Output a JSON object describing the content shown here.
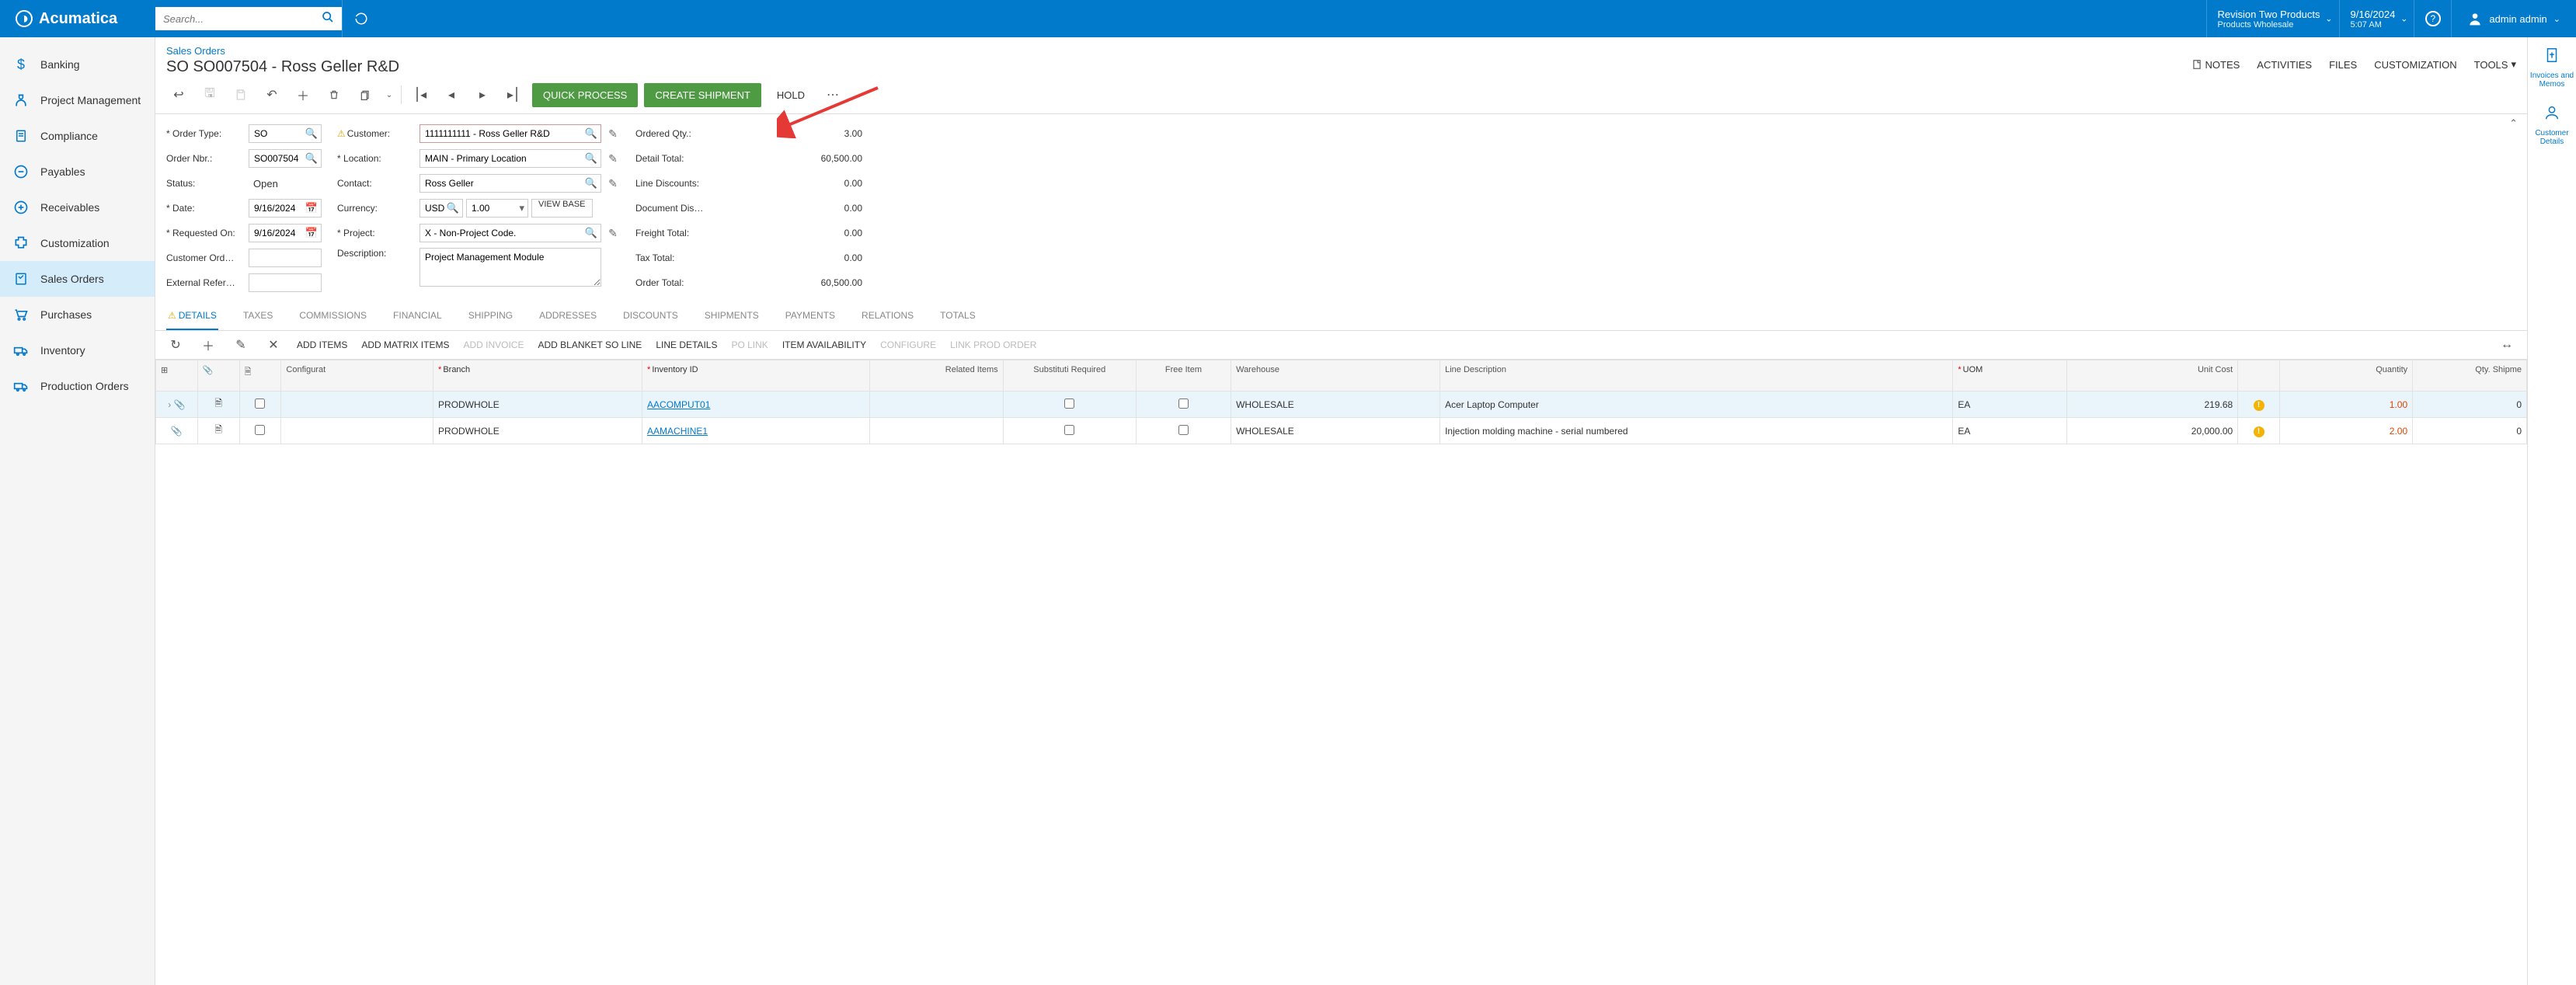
{
  "header": {
    "brand": "Acumatica",
    "search_placeholder": "Search...",
    "tenant": {
      "line1": "Revision Two Products",
      "line2": "Products Wholesale"
    },
    "datetime": {
      "line1": "9/16/2024",
      "line2": "5:07 AM"
    },
    "user": "admin admin"
  },
  "sidebar": {
    "items": [
      {
        "label": "Banking"
      },
      {
        "label": "Project Management"
      },
      {
        "label": "Compliance"
      },
      {
        "label": "Payables"
      },
      {
        "label": "Receivables"
      },
      {
        "label": "Customization"
      },
      {
        "label": "Sales Orders"
      },
      {
        "label": "Purchases"
      },
      {
        "label": "Inventory"
      },
      {
        "label": "Production Orders"
      }
    ]
  },
  "right_rail": {
    "items": [
      {
        "label": "Invoices and Memos"
      },
      {
        "label": "Customer Details"
      }
    ]
  },
  "page": {
    "breadcrumb": "Sales Orders",
    "title": "SO SO007504 - Ross Geller R&D",
    "actions": {
      "notes": "NOTES",
      "activities": "ACTIVITIES",
      "files": "FILES",
      "customization": "CUSTOMIZATION",
      "tools": "TOOLS"
    }
  },
  "toolbar": {
    "quick_process": "QUICK PROCESS",
    "create_shipment": "CREATE SHIPMENT",
    "hold": "HOLD"
  },
  "form": {
    "order_type": {
      "label": "Order Type:",
      "value": "SO"
    },
    "order_nbr": {
      "label": "Order Nbr.:",
      "value": "SO007504"
    },
    "status": {
      "label": "Status:",
      "value": "Open"
    },
    "date": {
      "label": "Date:",
      "value": "9/16/2024"
    },
    "requested_on": {
      "label": "Requested On:",
      "value": "9/16/2024"
    },
    "customer_ord": {
      "label": "Customer Ord…",
      "value": ""
    },
    "external_ref": {
      "label": "External Refer…",
      "value": ""
    },
    "customer": {
      "label": "Customer:",
      "value": "1111111111 - Ross Geller R&D"
    },
    "location": {
      "label": "Location:",
      "value": "MAIN - Primary Location"
    },
    "contact": {
      "label": "Contact:",
      "value": "Ross Geller"
    },
    "currency": {
      "label": "Currency:",
      "value": "USD",
      "rate": "1.00",
      "view_base": "VIEW BASE"
    },
    "project": {
      "label": "Project:",
      "value": "X - Non-Project Code."
    },
    "description": {
      "label": "Description:",
      "value": "Project Management Module"
    },
    "ordered_qty": {
      "label": "Ordered Qty.:",
      "value": "3.00"
    },
    "detail_total": {
      "label": "Detail Total:",
      "value": "60,500.00"
    },
    "line_discounts": {
      "label": "Line Discounts:",
      "value": "0.00"
    },
    "document_dis": {
      "label": "Document Dis…",
      "value": "0.00"
    },
    "freight_total": {
      "label": "Freight Total:",
      "value": "0.00"
    },
    "tax_total": {
      "label": "Tax Total:",
      "value": "0.00"
    },
    "order_total": {
      "label": "Order Total:",
      "value": "60,500.00"
    }
  },
  "tabs": [
    "DETAILS",
    "TAXES",
    "COMMISSIONS",
    "FINANCIAL",
    "SHIPPING",
    "ADDRESSES",
    "DISCOUNTS",
    "SHIPMENTS",
    "PAYMENTS",
    "RELATIONS",
    "TOTALS"
  ],
  "grid_toolbar": {
    "add_items": "ADD ITEMS",
    "add_matrix": "ADD MATRIX ITEMS",
    "add_invoice": "ADD INVOICE",
    "add_blanket": "ADD BLANKET SO LINE",
    "line_details": "LINE DETAILS",
    "po_link": "PO LINK",
    "item_avail": "ITEM AVAILABILITY",
    "configure": "CONFIGURE",
    "link_prod": "LINK PROD ORDER"
  },
  "grid": {
    "columns": {
      "configurat": "Configurat",
      "branch": "Branch",
      "inventory_id": "Inventory ID",
      "related_items": "Related Items",
      "substituti": "Substituti Required",
      "free_item": "Free Item",
      "warehouse": "Warehouse",
      "line_description": "Line Description",
      "uom": "UOM",
      "unit_cost": "Unit Cost",
      "quantity": "Quantity",
      "qty_shipme": "Qty. Shipme"
    },
    "rows": [
      {
        "branch": "PRODWHOLE",
        "inventory_id": "AACOMPUT01",
        "warehouse": "WHOLESALE",
        "line_description": "Acer Laptop Computer",
        "uom": "EA",
        "unit_cost": "219.68",
        "quantity": "1.00",
        "qty_shipme": "0"
      },
      {
        "branch": "PRODWHOLE",
        "inventory_id": "AAMACHINE1",
        "warehouse": "WHOLESALE",
        "line_description": "Injection molding machine - serial numbered",
        "uom": "EA",
        "unit_cost": "20,000.00",
        "quantity": "2.00",
        "qty_shipme": "0"
      }
    ]
  }
}
